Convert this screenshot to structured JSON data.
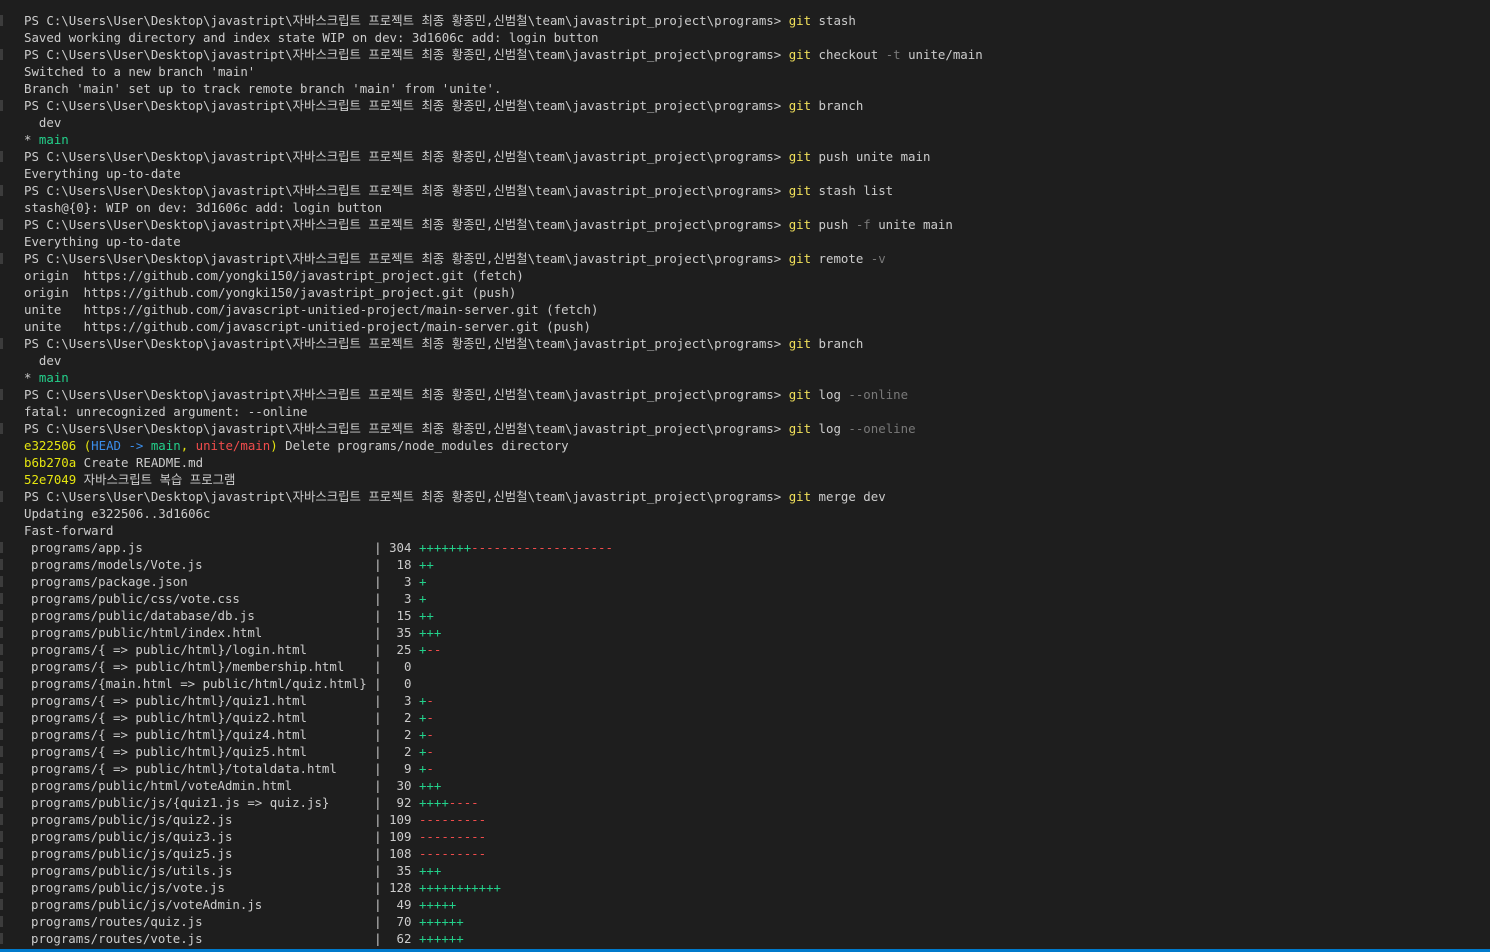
{
  "prompt": "PS C:\\Users\\User\\Desktop\\javastript\\자바스크립트 프로젝트 최종 황종민,신범철\\team\\javastript_project\\programs> ",
  "colors": {
    "background": "#1e1e1e",
    "text": "#cccccc",
    "command": "#f1e05a",
    "flag": "#797979",
    "plus": "#23d18b",
    "minus": "#f14c4c",
    "head": "#3b8eea",
    "hash": "#e5e510",
    "statusbar": "#007acc"
  },
  "lines": [
    {
      "kind": "cmd",
      "cmd": "git",
      "args": [
        [
          "t",
          " stash"
        ]
      ]
    },
    {
      "kind": "out",
      "text": "Saved working directory and index state WIP on dev: 3d1606c add: login button"
    },
    {
      "kind": "cmd",
      "cmd": "git",
      "args": [
        [
          "t",
          " checkout "
        ],
        [
          "m",
          "-t"
        ],
        [
          "t",
          " unite/main"
        ]
      ]
    },
    {
      "kind": "out",
      "text": "Switched to a new branch 'main'"
    },
    {
      "kind": "out",
      "text": "Branch 'main' set up to track remote branch 'main' from 'unite'."
    },
    {
      "kind": "cmd",
      "cmd": "git",
      "args": [
        [
          "t",
          " branch"
        ]
      ]
    },
    {
      "kind": "out",
      "text": "  dev"
    },
    {
      "kind": "branch",
      "star": "* ",
      "name": "main"
    },
    {
      "kind": "cmd",
      "cmd": "git",
      "args": [
        [
          "t",
          " push unite main"
        ]
      ]
    },
    {
      "kind": "out",
      "text": "Everything up-to-date"
    },
    {
      "kind": "cmd",
      "cmd": "git",
      "args": [
        [
          "t",
          " stash list"
        ]
      ]
    },
    {
      "kind": "out",
      "text": "stash@{0}: WIP on dev: 3d1606c add: login button"
    },
    {
      "kind": "cmd",
      "cmd": "git",
      "args": [
        [
          "t",
          " push "
        ],
        [
          "m",
          "-f"
        ],
        [
          "t",
          " unite main"
        ]
      ]
    },
    {
      "kind": "out",
      "text": "Everything up-to-date"
    },
    {
      "kind": "cmd",
      "cmd": "git",
      "args": [
        [
          "t",
          " remote "
        ],
        [
          "m",
          "-v"
        ]
      ]
    },
    {
      "kind": "out",
      "text": "origin  https://github.com/yongki150/javastript_project.git (fetch)"
    },
    {
      "kind": "out",
      "text": "origin  https://github.com/yongki150/javastript_project.git (push)"
    },
    {
      "kind": "out",
      "text": "unite   https://github.com/javascript-unitied-project/main-server.git (fetch)"
    },
    {
      "kind": "out",
      "text": "unite   https://github.com/javascript-unitied-project/main-server.git (push)"
    },
    {
      "kind": "cmd",
      "cmd": "git",
      "args": [
        [
          "t",
          " branch"
        ]
      ]
    },
    {
      "kind": "out",
      "text": "  dev"
    },
    {
      "kind": "branch",
      "star": "* ",
      "name": "main"
    },
    {
      "kind": "cmd",
      "cmd": "git",
      "args": [
        [
          "t",
          " log "
        ],
        [
          "m",
          "--online"
        ]
      ]
    },
    {
      "kind": "out",
      "text": "fatal: unrecognized argument: --online"
    },
    {
      "kind": "cmd",
      "cmd": "git",
      "args": [
        [
          "t",
          " log "
        ],
        [
          "m",
          "--oneline"
        ]
      ]
    },
    {
      "kind": "spans",
      "spans": [
        [
          "y",
          "e322506"
        ],
        [
          "t",
          " "
        ],
        [
          "y",
          "("
        ],
        [
          "b",
          "HEAD -> "
        ],
        [
          "g",
          "main"
        ],
        [
          "y",
          ", "
        ],
        [
          "r",
          "unite/main"
        ],
        [
          "y",
          ")"
        ],
        [
          "t",
          " Delete programs/node_modules directory"
        ]
      ]
    },
    {
      "kind": "spans",
      "spans": [
        [
          "y",
          "b6b270a"
        ],
        [
          "t",
          " Create README.md"
        ]
      ]
    },
    {
      "kind": "spans",
      "spans": [
        [
          "y",
          "52e7049"
        ],
        [
          "t",
          " 자바스크립트 복습 프로그램"
        ]
      ]
    },
    {
      "kind": "cmd",
      "cmd": "git",
      "args": [
        [
          "t",
          " merge dev"
        ]
      ]
    },
    {
      "kind": "out",
      "text": "Updating e322506..3d1606c"
    },
    {
      "kind": "out",
      "text": "Fast-forward"
    },
    {
      "kind": "stat",
      "file": "programs/app.js",
      "count": "304",
      "plus": "+++++++",
      "minus": "-------------------"
    },
    {
      "kind": "stat",
      "file": "programs/models/Vote.js",
      "count": "18",
      "plus": "++",
      "minus": ""
    },
    {
      "kind": "stat",
      "file": "programs/package.json",
      "count": "3",
      "plus": "+",
      "minus": ""
    },
    {
      "kind": "stat",
      "file": "programs/public/css/vote.css",
      "count": "3",
      "plus": "+",
      "minus": ""
    },
    {
      "kind": "stat",
      "file": "programs/public/database/db.js",
      "count": "15",
      "plus": "++",
      "minus": ""
    },
    {
      "kind": "stat",
      "file": "programs/public/html/index.html",
      "count": "35",
      "plus": "+++",
      "minus": ""
    },
    {
      "kind": "stat",
      "file": "programs/{ => public/html}/login.html",
      "count": "25",
      "plus": "+",
      "minus": "--"
    },
    {
      "kind": "stat",
      "file": "programs/{ => public/html}/membership.html",
      "count": "0",
      "plus": "",
      "minus": ""
    },
    {
      "kind": "stat",
      "file": "programs/{main.html => public/html/quiz.html}",
      "count": "0",
      "plus": "",
      "minus": ""
    },
    {
      "kind": "stat",
      "file": "programs/{ => public/html}/quiz1.html",
      "count": "3",
      "plus": "+",
      "minus": "-"
    },
    {
      "kind": "stat",
      "file": "programs/{ => public/html}/quiz2.html",
      "count": "2",
      "plus": "+",
      "minus": "-"
    },
    {
      "kind": "stat",
      "file": "programs/{ => public/html}/quiz4.html",
      "count": "2",
      "plus": "+",
      "minus": "-"
    },
    {
      "kind": "stat",
      "file": "programs/{ => public/html}/quiz5.html",
      "count": "2",
      "plus": "+",
      "minus": "-"
    },
    {
      "kind": "stat",
      "file": "programs/{ => public/html}/totaldata.html",
      "count": "9",
      "plus": "+",
      "minus": "-"
    },
    {
      "kind": "stat",
      "file": "programs/public/html/voteAdmin.html",
      "count": "30",
      "plus": "+++",
      "minus": ""
    },
    {
      "kind": "stat",
      "file": "programs/public/js/{quiz1.js => quiz.js}",
      "count": "92",
      "plus": "++++",
      "minus": "----"
    },
    {
      "kind": "stat",
      "file": "programs/public/js/quiz2.js",
      "count": "109",
      "plus": "",
      "minus": "---------"
    },
    {
      "kind": "stat",
      "file": "programs/public/js/quiz3.js",
      "count": "109",
      "plus": "",
      "minus": "---------"
    },
    {
      "kind": "stat",
      "file": "programs/public/js/quiz5.js",
      "count": "108",
      "plus": "",
      "minus": "---------"
    },
    {
      "kind": "stat",
      "file": "programs/public/js/utils.js",
      "count": "35",
      "plus": "+++",
      "minus": ""
    },
    {
      "kind": "stat",
      "file": "programs/public/js/vote.js",
      "count": "128",
      "plus": "+++++++++++",
      "minus": ""
    },
    {
      "kind": "stat",
      "file": "programs/public/js/voteAdmin.js",
      "count": "49",
      "plus": "+++++",
      "minus": ""
    },
    {
      "kind": "stat",
      "file": "programs/routes/quiz.js",
      "count": "70",
      "plus": "++++++",
      "minus": ""
    },
    {
      "kind": "stat",
      "file": "programs/routes/vote.js",
      "count": "62",
      "plus": "++++++",
      "minus": ""
    }
  ]
}
